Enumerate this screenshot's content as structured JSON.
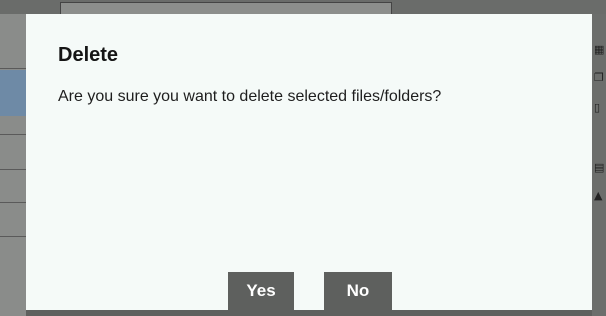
{
  "dialog": {
    "title": "Delete",
    "message": "Are you sure you want to delete selected files/folders?",
    "buttons": {
      "yes_label": "Yes",
      "no_label": "No"
    }
  },
  "colors": {
    "dialog_background": "#f5faf8",
    "button_background": "#5e605e",
    "button_text": "#ffffff",
    "overlay": "#5e605e"
  }
}
